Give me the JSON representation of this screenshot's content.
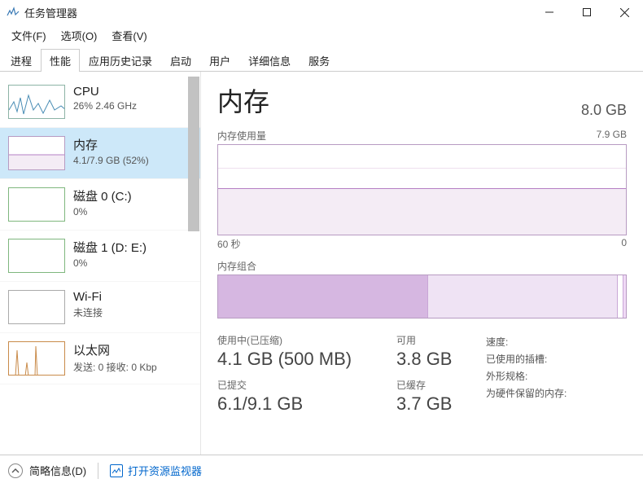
{
  "window": {
    "title": "任务管理器"
  },
  "menus": {
    "file": "文件(F)",
    "options": "选项(O)",
    "view": "查看(V)"
  },
  "tabs": [
    "进程",
    "性能",
    "应用历史记录",
    "启动",
    "用户",
    "详细信息",
    "服务"
  ],
  "active_tab": 1,
  "sidebar": {
    "items": [
      {
        "label": "CPU",
        "sub": "26%  2.46 GHz",
        "kind": "cpu"
      },
      {
        "label": "内存",
        "sub": "4.1/7.9 GB (52%)",
        "kind": "mem",
        "selected": true
      },
      {
        "label": "磁盘 0 (C:)",
        "sub": "0%",
        "kind": "disk"
      },
      {
        "label": "磁盘 1 (D: E:)",
        "sub": "0%",
        "kind": "disk"
      },
      {
        "label": "Wi-Fi",
        "sub": "未连接",
        "kind": "wifi"
      },
      {
        "label": "以太网",
        "sub": "发送: 0 接收: 0 Kbp",
        "kind": "eth"
      }
    ]
  },
  "main": {
    "title": "内存",
    "capacity": "8.0 GB",
    "graph": {
      "header": "内存使用量",
      "max_label": "7.9 GB",
      "x_left": "60 秒",
      "x_right": "0"
    },
    "composition": {
      "header": "内存组合"
    },
    "stats": {
      "in_use_label": "使用中(已压缩)",
      "in_use_value": "4.1 GB (500 MB)",
      "available_label": "可用",
      "available_value": "3.8 GB",
      "committed_label": "已提交",
      "committed_value": "6.1/9.1 GB",
      "cached_label": "已缓存",
      "cached_value": "3.7 GB",
      "speed_label": "速度:",
      "slots_label": "已使用的插槽:",
      "form_label": "外形规格:",
      "reserved_label": "为硬件保留的内存:"
    }
  },
  "footer": {
    "brief": "简略信息(D)",
    "resmon": "打开资源监视器"
  },
  "colors": {
    "accent_mem": "#b580c4",
    "selection": "#cde8f9"
  }
}
